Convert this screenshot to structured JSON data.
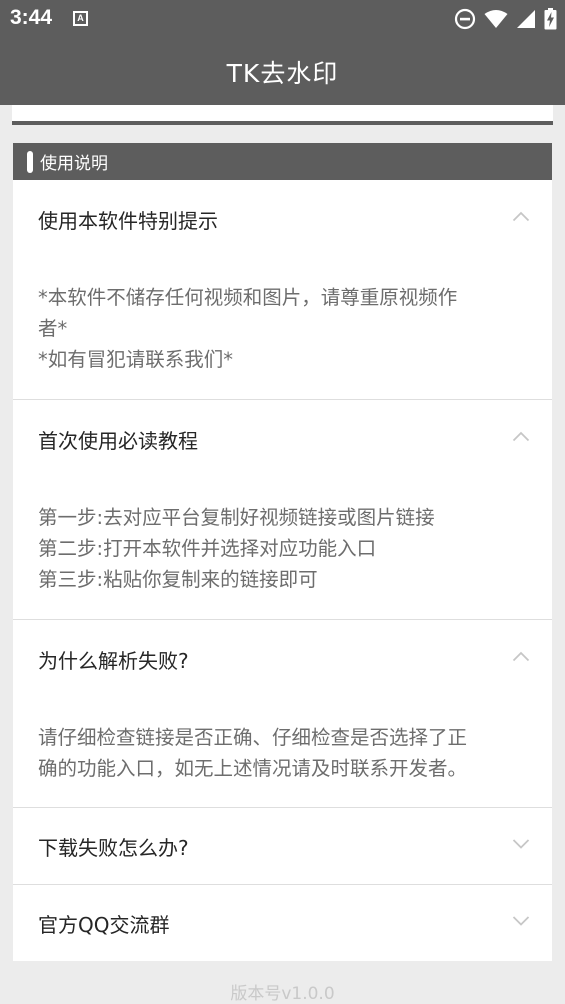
{
  "status": {
    "time": "3:44",
    "a_icon": "A"
  },
  "app": {
    "title": "TK去水印"
  },
  "section": {
    "title": "使用说明"
  },
  "panels": [
    {
      "title": "使用本软件特别提示",
      "expanded": true,
      "lines": [
        "*本软件不储存任何视频和图片，请尊重原视频作",
        "者*",
        "*如有冒犯请联系我们*"
      ]
    },
    {
      "title": "首次使用必读教程",
      "expanded": true,
      "lines": [
        "第一步:去对应平台复制好视频链接或图片链接",
        "第二步:打开本软件并选择对应功能入口",
        "第三步:粘贴你复制来的链接即可"
      ]
    },
    {
      "title": "为什么解析失败?",
      "expanded": true,
      "lines": [
        "请仔细检查链接是否正确、仔细检查是否选择了正",
        "确的功能入口，如无上述情况请及时联系开发者。"
      ]
    },
    {
      "title": "下载失败怎么办?",
      "expanded": false,
      "lines": []
    },
    {
      "title": "官方QQ交流群",
      "expanded": false,
      "lines": []
    }
  ],
  "footer": {
    "version": "版本号v1.0.0"
  },
  "colors": {
    "bar": "#5d5d5d",
    "background": "#ececec",
    "body_text": "#6d6d6d"
  }
}
